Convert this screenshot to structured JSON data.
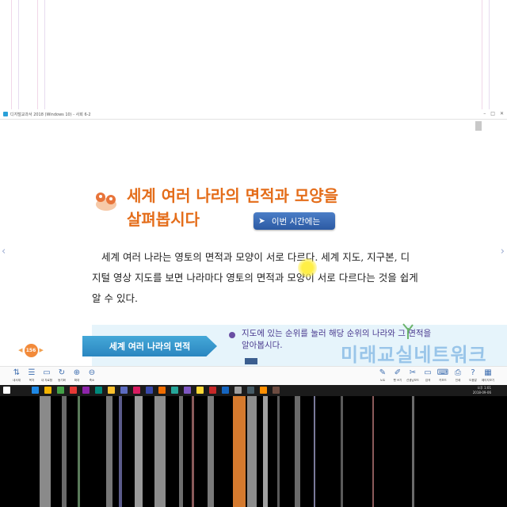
{
  "window": {
    "title": "디지털교과서 2018 (Windows 10) - 사회 6-2"
  },
  "lesson": {
    "heading_line1": "세계 여러 나라의 면적과 모양을",
    "heading_line2": "살펴봅시다",
    "this_time_label": "이번 시간에는",
    "body_text": "세계 여러 나라는 영토의 면적과 모양이 서로 다르다. 세계 지도, 지구본, 디지털 영상 지도를 보면 나라마다 영토의 면적과 모양이 서로 다르다는 것을 쉽게 알 수 있다.",
    "section_label": "세계 여러 나라의 면적",
    "bullet_text": "지도에 있는 순위를 눌러 해당 순위의 나라와 그 면적을 알아봅시다.",
    "page_number": "156",
    "watermark": "미래교실네트워크"
  },
  "toolbar": {
    "left": [
      {
        "name": "my-book",
        "icon": "⇅",
        "label": "내서재"
      },
      {
        "name": "contents",
        "icon": "☰",
        "label": "목차"
      },
      {
        "name": "my-data",
        "icon": "▭",
        "label": "내 자료함"
      },
      {
        "name": "sync",
        "icon": "↻",
        "label": "동기화"
      },
      {
        "name": "zoom-in",
        "icon": "⊕",
        "label": "확대"
      },
      {
        "name": "zoom-out",
        "icon": "⊖",
        "label": "축소"
      }
    ],
    "right": [
      {
        "name": "note",
        "icon": "✎",
        "label": "노트"
      },
      {
        "name": "pen",
        "icon": "✐",
        "label": "펜 쓰기"
      },
      {
        "name": "teacher-mode",
        "icon": "✂",
        "label": "선생님모드"
      },
      {
        "name": "eraser",
        "icon": "▭",
        "label": "검색"
      },
      {
        "name": "keyboard",
        "icon": "⌨",
        "label": "키보드"
      },
      {
        "name": "print",
        "icon": "⎙",
        "label": "인쇄"
      },
      {
        "name": "help",
        "icon": "?",
        "label": "도움말"
      },
      {
        "name": "view-mode",
        "icon": "▦",
        "label": "페이지보기"
      }
    ]
  },
  "taskbar": {
    "time": "오후 1:01",
    "date": "2018-09-06",
    "icon_colors": [
      "#1e88e5",
      "#f4b400",
      "#43a047",
      "#e53935",
      "#8e24aa",
      "#00897b",
      "#fbc02d",
      "#5c6bc0",
      "#d81b60",
      "#3949ab",
      "#ef6c00",
      "#26a69a",
      "#7e57c2",
      "#fdd835",
      "#c62828",
      "#1565c0",
      "#9e9e9e",
      "#455a64",
      "#ff8f00",
      "#6d4c41"
    ]
  },
  "colors": {
    "heading": "#e46d1a",
    "accent_blue": "#2c5aa3",
    "section_blue": "#2a86c0"
  }
}
